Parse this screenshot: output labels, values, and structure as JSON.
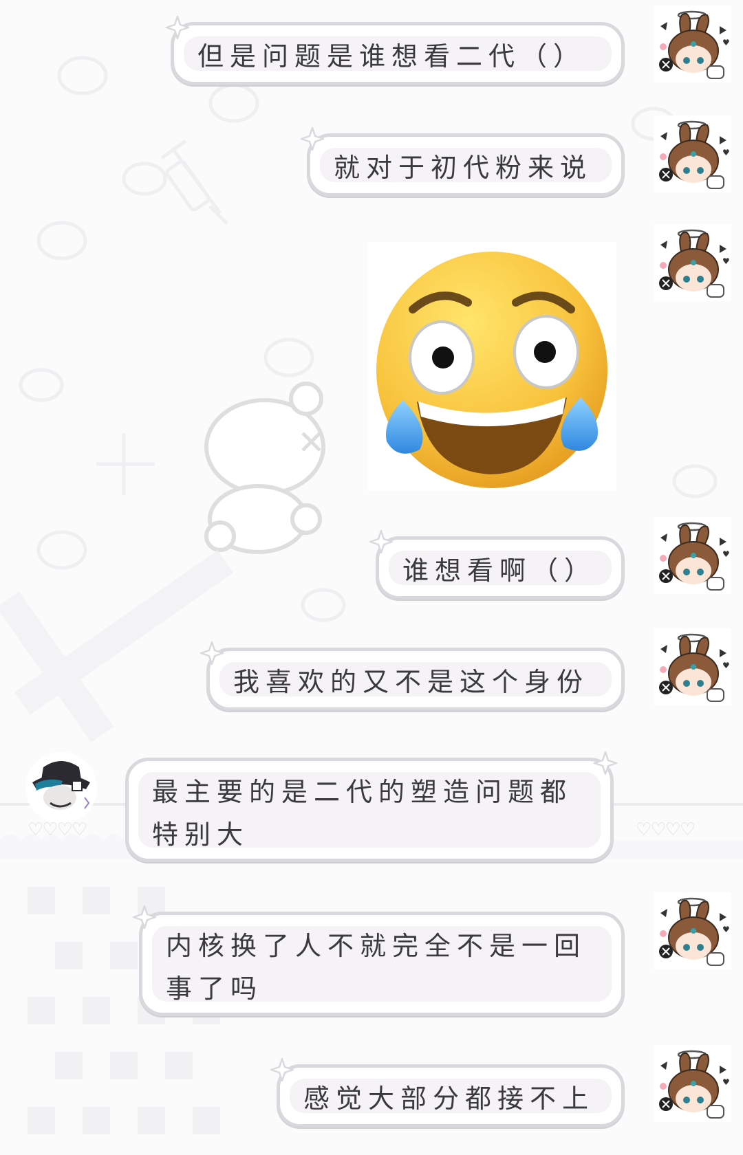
{
  "messages": [
    {
      "side": "right",
      "text": "但是问题是谁想看二代（）"
    },
    {
      "side": "right",
      "text": "就对于初代粉来说"
    },
    {
      "side": "right",
      "type": "sticker",
      "sticker": "crying-laughing-emoji"
    },
    {
      "side": "right",
      "text": "谁想看啊（）"
    },
    {
      "side": "right",
      "text": "我喜欢的又不是这个身份"
    },
    {
      "side": "left",
      "text": "最主要的是二代的塑造问题都\n特别大"
    },
    {
      "side": "right",
      "text": "内核换了人不就完全不是一回\n事了吗"
    },
    {
      "side": "right",
      "text": "感觉大部分都接不上"
    }
  ],
  "avatars": {
    "self": "bunny-halo-avatar-icon",
    "other": "hat-character-avatar-icon"
  },
  "colors": {
    "bubble_border": "#d9d9dd",
    "bubble_fill": "#ffffff",
    "bubble_inner": "#f5f3f6",
    "text": "#3a3a3e",
    "background": "#fbfbfc"
  }
}
